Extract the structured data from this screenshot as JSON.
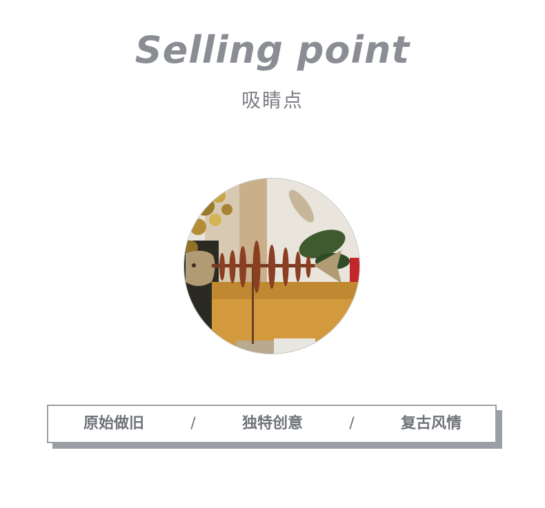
{
  "header": {
    "title": "Selling point",
    "subtitle": "吸睛点"
  },
  "image": {
    "icon": "fish-skeleton-decoration-photo"
  },
  "tags": {
    "items": [
      "原始做旧",
      "独特创意",
      "复古风情"
    ],
    "separator": "/"
  },
  "colors": {
    "text_gray": "#8a8d93",
    "frame_gray": "#9a9ea5",
    "background": "#ffffff"
  }
}
